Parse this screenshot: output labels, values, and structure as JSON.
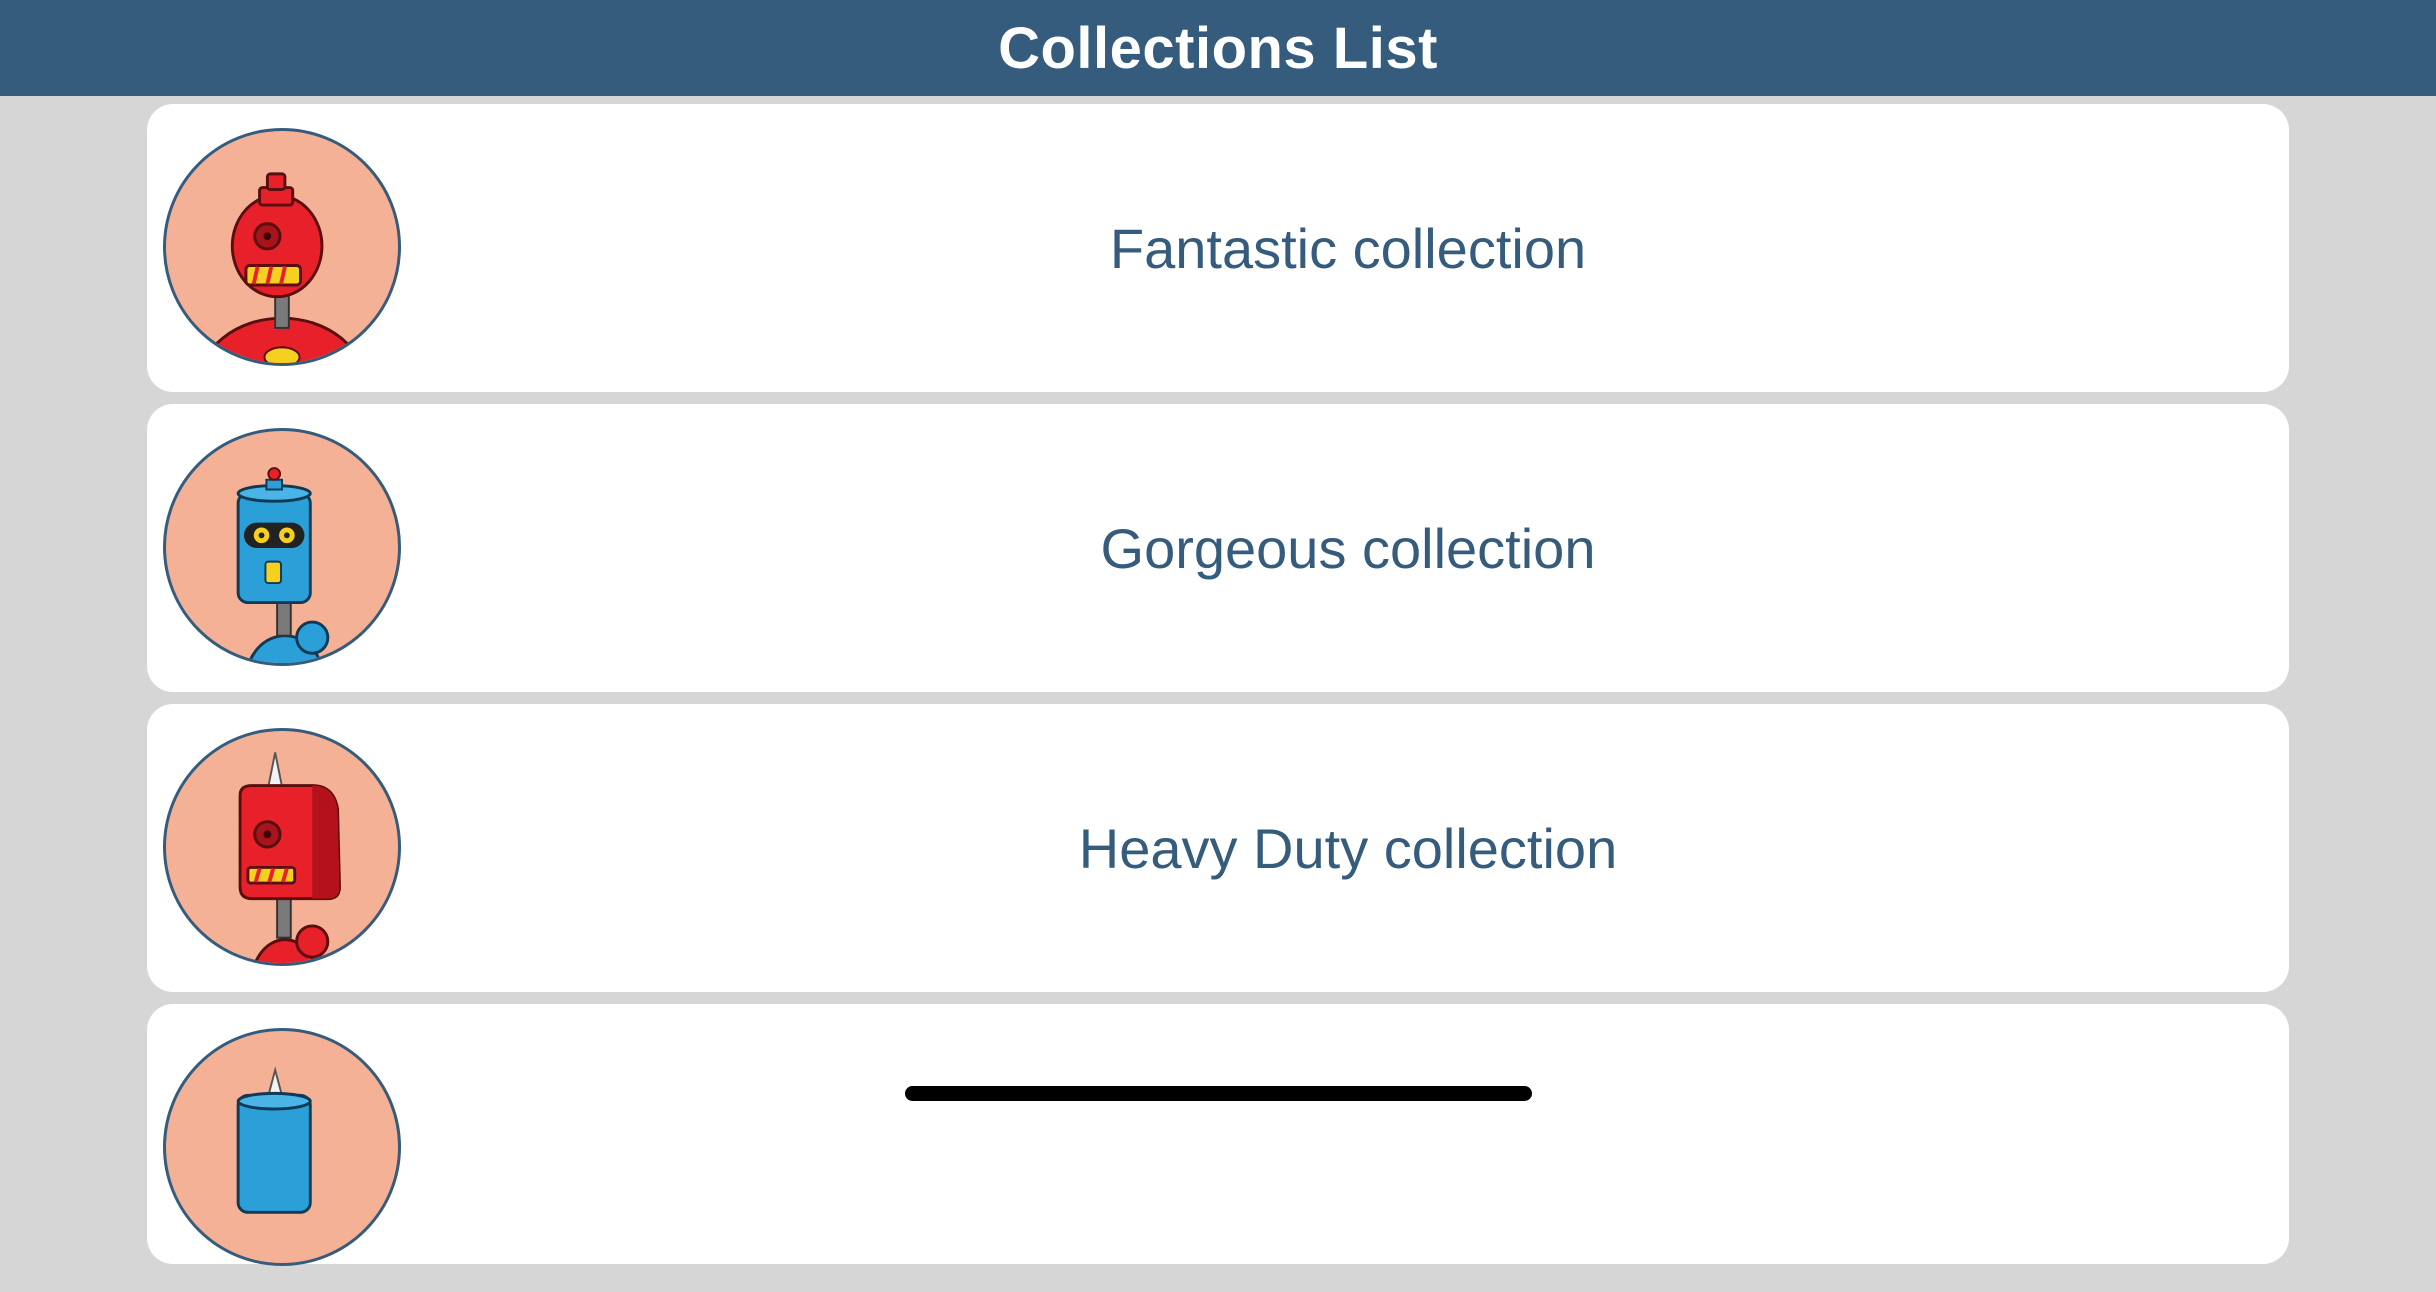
{
  "navbar": {
    "title": "Collections List"
  },
  "colors": {
    "navbar_bg": "#355c7d",
    "page_bg": "#d6d6d6",
    "card_bg": "#ffffff",
    "label_text": "#355c7d",
    "avatar_bg": "#f4b195"
  },
  "collections": [
    {
      "label": "Fantastic collection",
      "avatar_icon": "red-round-robot-icon"
    },
    {
      "label": "Gorgeous collection",
      "avatar_icon": "blue-cylinder-robot-icon"
    },
    {
      "label": "Heavy Duty collection",
      "avatar_icon": "red-box-robot-icon"
    },
    {
      "label": "",
      "avatar_icon": "blue-spike-robot-icon"
    }
  ]
}
